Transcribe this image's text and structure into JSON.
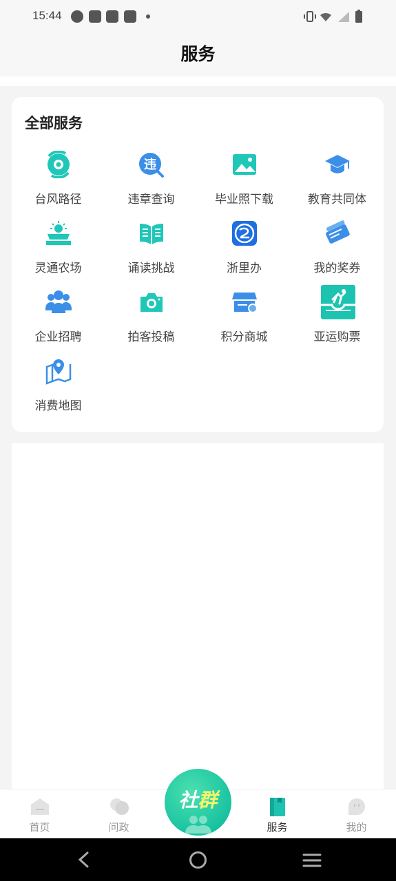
{
  "status_bar": {
    "time": "15:44"
  },
  "header": {
    "title": "服务"
  },
  "services": {
    "title": "全部服务",
    "items": [
      {
        "label": "台风路径",
        "icon": "typhoon-icon"
      },
      {
        "label": "违章查询",
        "icon": "violation-icon"
      },
      {
        "label": "毕业照下载",
        "icon": "image-icon"
      },
      {
        "label": "教育共同体",
        "icon": "graduation-cap-icon"
      },
      {
        "label": "灵通农场",
        "icon": "solar-farm-icon"
      },
      {
        "label": "诵读挑战",
        "icon": "book-icon"
      },
      {
        "label": "浙里办",
        "icon": "zheliban-icon"
      },
      {
        "label": "我的奖券",
        "icon": "ticket-icon"
      },
      {
        "label": "企业招聘",
        "icon": "people-icon"
      },
      {
        "label": "拍客投稿",
        "icon": "camera-icon"
      },
      {
        "label": "积分商城",
        "icon": "store-icon"
      },
      {
        "label": "亚运购票",
        "icon": "asian-games-icon"
      },
      {
        "label": "消费地图",
        "icon": "map-icon"
      }
    ]
  },
  "tabbar": {
    "home": "首页",
    "ask": "问政",
    "community": {
      "part1": "社",
      "part2": "群"
    },
    "services": "服务",
    "mine": "我的"
  },
  "colors": {
    "accent_blue": "#3b8fe8",
    "accent_teal": "#1cc3b0",
    "brand_green": "#19c3a0"
  }
}
